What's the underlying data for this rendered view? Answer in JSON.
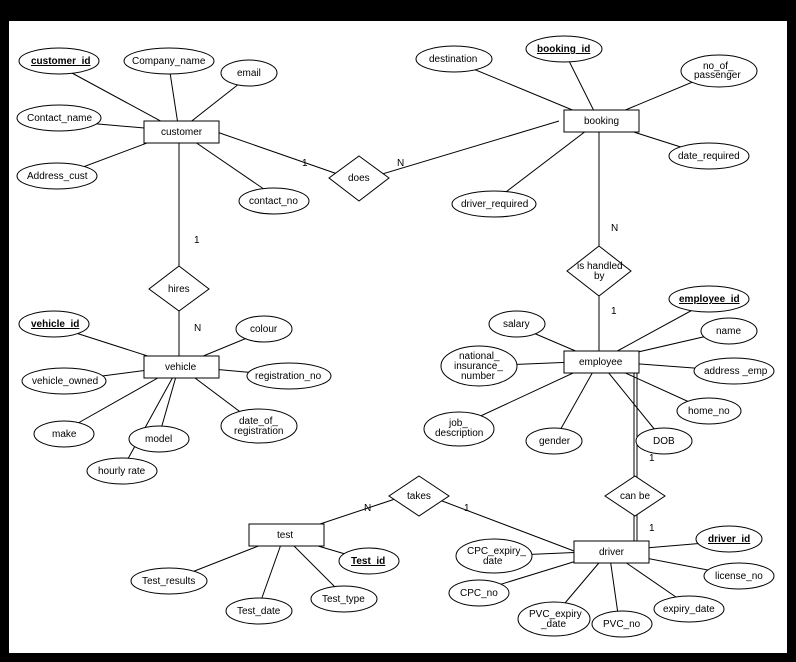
{
  "entities": {
    "customer": "customer",
    "booking": "booking",
    "vehicle": "vehicle",
    "employee": "employee",
    "test": "test",
    "driver": "driver"
  },
  "relationships": {
    "does": "does",
    "hires": "hires",
    "is_handled_by": "is handled\nby",
    "takes": "takes",
    "can_be": "can be"
  },
  "cardinality": {
    "one": "1",
    "many": "N"
  },
  "attributes": {
    "customer_id": "customer_id",
    "company_name": "Company_name",
    "email": "email",
    "contact_name": "Contact_name",
    "address_cust": "Address_cust",
    "contact_no": "contact_no",
    "booking_id": "booking_id",
    "destination": "destination",
    "no_of_passenger": "no_of_\npassenger",
    "date_required": "date_required",
    "driver_required": "driver_required",
    "vehicle_id": "vehicle_id",
    "vehicle_owned": "vehicle_owned",
    "make": "make",
    "model": "model",
    "hourly_rate": "hourly rate",
    "colour": "colour",
    "registration_no": "registration_no",
    "date_of_registration": "date_of_\nregistration",
    "employee_id": "employee_id",
    "name": "name",
    "salary": "salary",
    "national_insurance_number": "national_\ninsurance_\nnumber",
    "address_emp": "address _emp",
    "home_no": "home_no",
    "job_description": "job_\ndescription",
    "gender": "gender",
    "dob": "DOB",
    "test_id": "Test_id",
    "test_results": "Test_results",
    "test_date": "Test_date",
    "test_type": "Test_type",
    "driver_id": "driver_id",
    "cpc_expiry_date": "CPC_expiry_\ndate",
    "cpc_no": "CPC_no",
    "pvc_expiry_date": "PVC_expiry\n_date",
    "pvc_no": "PVC_no",
    "license_no": "license_no",
    "expiry_date": "expiry_date"
  }
}
